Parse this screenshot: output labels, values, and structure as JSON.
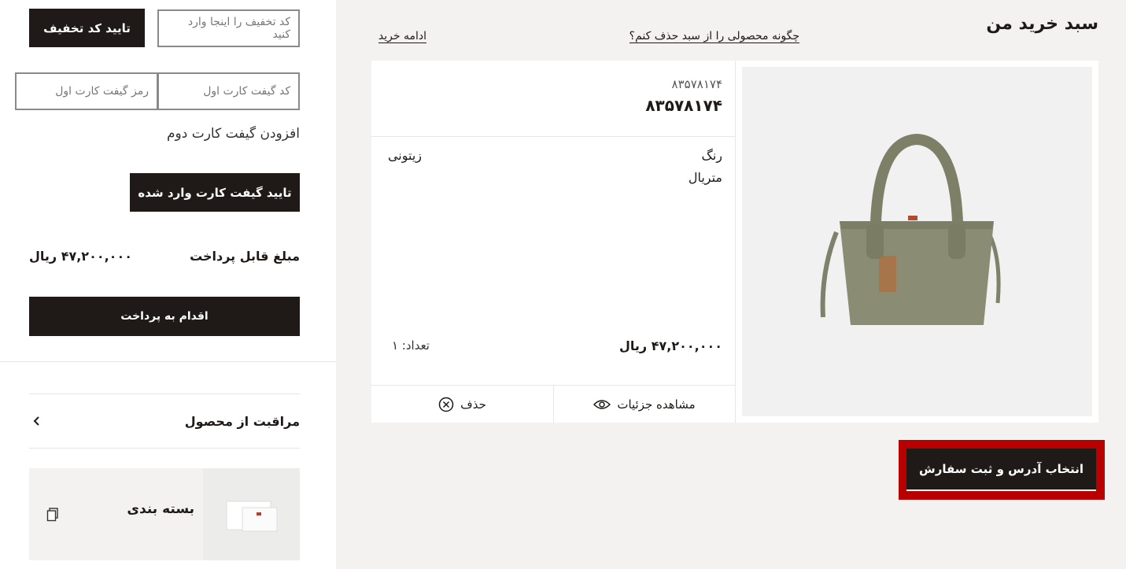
{
  "discount": {
    "placeholder": "کد تخفیف را اینجا وارد کنید",
    "apply_label": "تایید کد تخفیف"
  },
  "giftcard": {
    "code_placeholder": "کد گیفت کارت اول",
    "pin_placeholder": "رمز گیفت کارت اول",
    "add_second_label": "افزودن گیفت کارت دوم",
    "confirm_label": "تایید گیفت کارت وارد شده"
  },
  "summary": {
    "payable_label": "مبلغ قابل پرداخت",
    "payable_value": "۴۷,۲۰۰,۰۰۰ ریال",
    "proceed_label": "اقدام به پرداخت"
  },
  "care": {
    "title": "مراقبت از محصول"
  },
  "packaging": {
    "title": "بسته بندی"
  },
  "cart": {
    "title": "سبد خرید من",
    "how_remove_link": "چگونه محصولی را از سبد حذف کنم؟",
    "continue_link": "ادامه خرید",
    "item": {
      "sku_small": "۸۳۵۷۸۱۷۴",
      "sku_bold": "۸۳۵۷۸۱۷۴",
      "color_label": "رنگ",
      "color_value": "زیتونی",
      "material_label": "متریال",
      "price": "۴۷,۲۰۰,۰۰۰ ریال",
      "quantity": "تعداد: ۱",
      "view_details_label": "مشاهده جزئیات",
      "remove_label": "حذف"
    },
    "checkout_label": "انتخاب آدرس و ثبت سفارش"
  },
  "colors": {
    "dark": "#1f1a17",
    "panel_bg": "#f3f2f1",
    "highlight": "#b90000",
    "bag": "#8b8c74"
  },
  "icons": [
    "chevron-left-icon",
    "copy-icon",
    "eye-icon",
    "close-circle-icon"
  ]
}
